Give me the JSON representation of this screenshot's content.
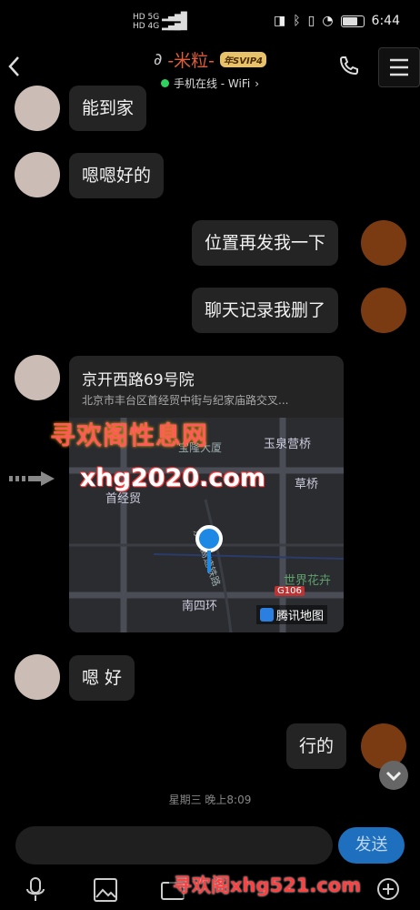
{
  "status_bar": {
    "network_left": "HD 5G",
    "network_right": "HD 4G",
    "time": "6:44"
  },
  "header": {
    "contact_name": "-米粒-",
    "vip_badge": "年SVIP4",
    "online_status": "手机在线 - WiFi",
    "status_color": "#2fd15f",
    "name_color": "#e05d3b"
  },
  "messages": [
    {
      "side": "left",
      "text": "能到家"
    },
    {
      "side": "left",
      "text": "嗯嗯好的"
    },
    {
      "side": "right",
      "text": "位置再发我一下"
    },
    {
      "side": "right",
      "text": "聊天记录我删了"
    },
    {
      "side": "left",
      "type": "location",
      "title": "京开西路69号院",
      "address": "北京市丰台区首经贸中街与纪家庙路交叉...",
      "map_labels": [
        "宝隆大厦",
        "玉泉营桥",
        "首经贸",
        "草桥",
        "京沪高速铁路",
        "世界花卉",
        "南四环",
        "G106"
      ],
      "map_brand": "腾讯地图"
    },
    {
      "side": "left",
      "text": "嗯 好"
    },
    {
      "side": "right",
      "text": "行的"
    }
  ],
  "timestamp": "星期三 晚上8:09",
  "watermarks": {
    "top": "寻欢阁性息网",
    "mid": "xhg2020.com",
    "bottom": "寻欢阁xhg521.com"
  },
  "input": {
    "send_label": "发送",
    "accent": "#1f6fbf"
  }
}
